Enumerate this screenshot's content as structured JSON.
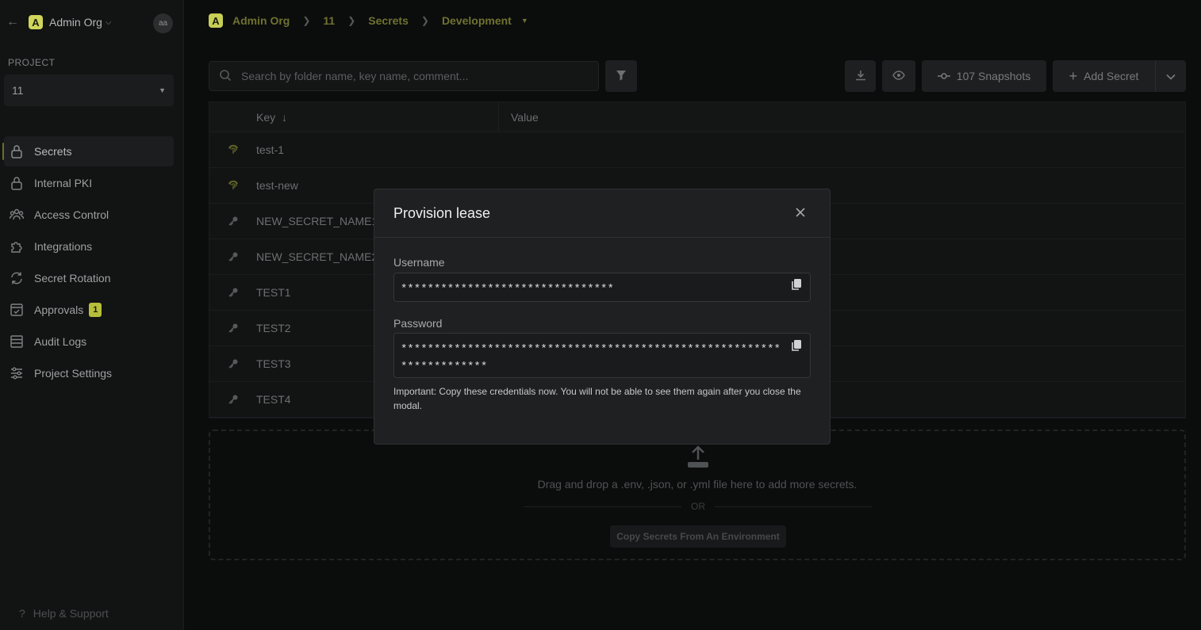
{
  "sidebar": {
    "org_name": "Admin Org",
    "org_initial": "A",
    "avatar_initials": "aa",
    "project_label": "PROJECT",
    "project_value": "11",
    "nav": [
      {
        "label": "Secrets",
        "icon": "lock-icon",
        "active": true
      },
      {
        "label": "Internal PKI",
        "icon": "lock-icon"
      },
      {
        "label": "Access Control",
        "icon": "users-icon"
      },
      {
        "label": "Integrations",
        "icon": "puzzle-icon"
      },
      {
        "label": "Secret Rotation",
        "icon": "rotate-icon"
      },
      {
        "label": "Approvals",
        "icon": "checklist-icon",
        "badge": "1"
      },
      {
        "label": "Audit Logs",
        "icon": "list-icon"
      },
      {
        "label": "Project Settings",
        "icon": "sliders-icon"
      }
    ],
    "help": "Help & Support"
  },
  "breadcrumb": {
    "org_initial": "A",
    "org": "Admin Org",
    "project": "11",
    "section": "Secrets",
    "environment": "Development"
  },
  "toolbar": {
    "search_placeholder": "Search by folder name, key name, comment...",
    "snapshots_label": "107 Snapshots",
    "add_secret_label": "Add Secret"
  },
  "table": {
    "columns": [
      "Key",
      "Value"
    ],
    "rows": [
      {
        "key": "test-1",
        "type": "dynamic"
      },
      {
        "key": "test-new",
        "type": "dynamic"
      },
      {
        "key": "NEW_SECRET_NAME1",
        "type": "static"
      },
      {
        "key": "NEW_SECRET_NAME2",
        "type": "static"
      },
      {
        "key": "TEST1",
        "type": "static"
      },
      {
        "key": "TEST2",
        "type": "static"
      },
      {
        "key": "TEST3",
        "type": "static"
      },
      {
        "key": "TEST4",
        "type": "static"
      }
    ]
  },
  "dropzone": {
    "text": "Drag and drop a .env, .json, or .yml file here to add more secrets.",
    "or": "OR",
    "copy_button": "Copy Secrets From An Environment"
  },
  "modal": {
    "title": "Provision lease",
    "username_label": "Username",
    "username_value": "********************************",
    "password_label": "Password",
    "password_value": "**********************************************************************",
    "note": "Important: Copy these credentials now. You will not be able to see them again after you close the modal."
  },
  "colors": {
    "accent": "#cfd65a",
    "background": "#0b0c0c",
    "modal_bg": "#1f2021"
  }
}
